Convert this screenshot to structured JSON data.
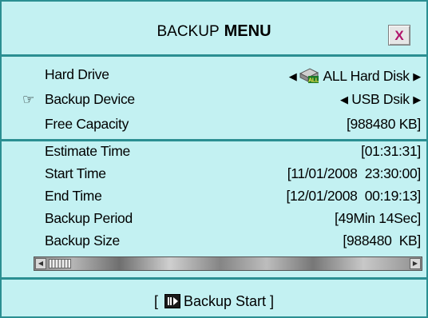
{
  "title": {
    "normal": "BACKUP",
    "bold": "MENU"
  },
  "close_label": "X",
  "settings": [
    {
      "label": "Hard Drive",
      "value": "ALL Hard Disk",
      "icon": "hard-disk-icon"
    },
    {
      "label": "Backup Device",
      "value": "USB Dsik",
      "icon": "pointer-hand-icon"
    },
    {
      "label": "Free Capacity",
      "value": "[988480 KB]"
    }
  ],
  "info": [
    {
      "label": "Estimate Time",
      "value": "[01:31:31]"
    },
    {
      "label": "Start Time",
      "value": "[11/01/2008  23:30:00]"
    },
    {
      "label": "End Time",
      "value": "[12/01/2008  00:19:13]"
    },
    {
      "label": "Backup Period",
      "value": "[49Min 14Sec]"
    },
    {
      "label": "Backup Size",
      "value": "[988480  KB]"
    }
  ],
  "footer": {
    "open": "[",
    "label": "Backup Start ]"
  },
  "colors": {
    "background": "#c3f1f2",
    "border": "#2b8f92",
    "close": "#b0126b"
  }
}
